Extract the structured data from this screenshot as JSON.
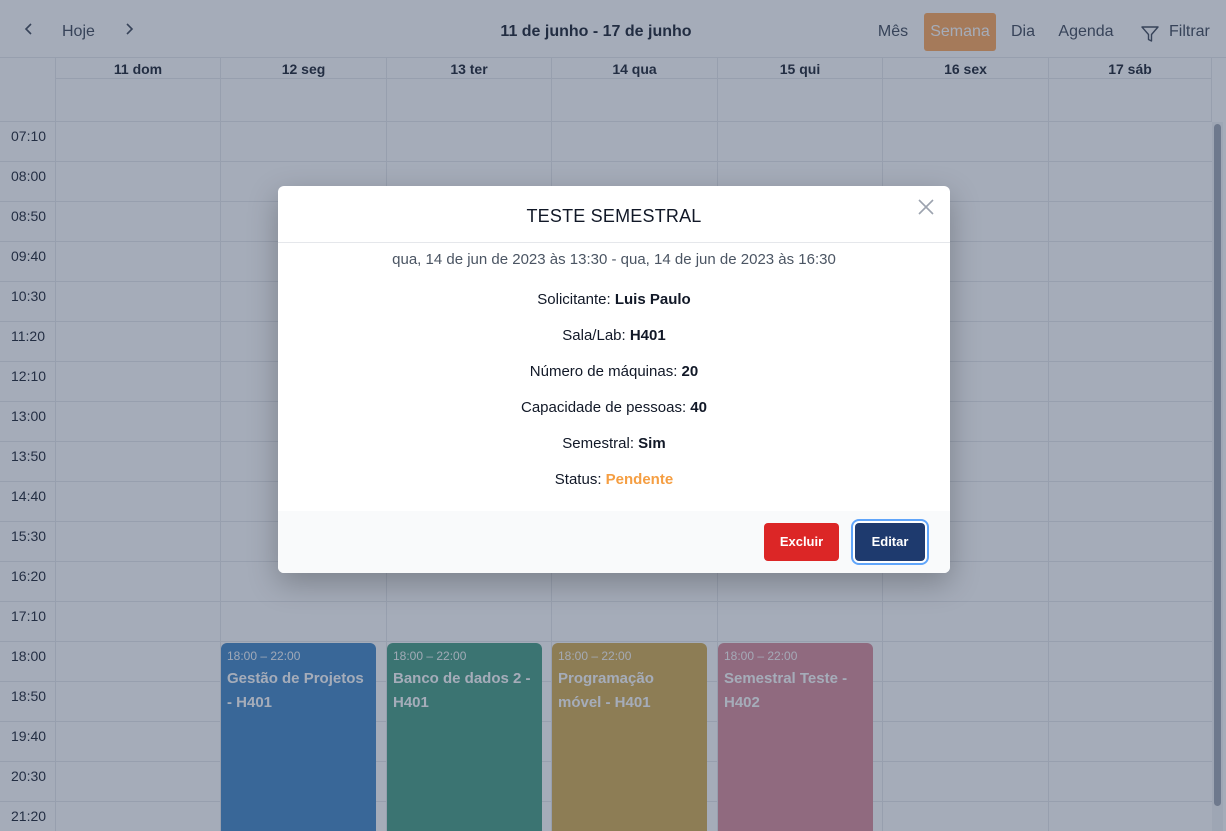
{
  "toolbar": {
    "today_label": "Hoje",
    "range_title": "11 de junho - 17 de junho",
    "views": [
      "Mês",
      "Semana",
      "Dia",
      "Agenda"
    ],
    "active_view": "Semana",
    "filter_label": "Filtrar"
  },
  "days": [
    "11 dom",
    "12 seg",
    "13 ter",
    "14 qua",
    "15 qui",
    "16 sex",
    "17 sáb"
  ],
  "times": [
    "07:10",
    "08:00",
    "08:50",
    "09:40",
    "10:30",
    "11:20",
    "12:10",
    "13:00",
    "13:50",
    "14:40",
    "15:30",
    "16:20",
    "17:10",
    "18:00",
    "18:50",
    "19:40",
    "20:30",
    "21:20"
  ],
  "events": [
    {
      "time": "18:00 – 22:00",
      "title": "Gestão de Projetos - H401",
      "color": "#3b82c4"
    },
    {
      "time": "18:00 – 22:00",
      "title": "Banco de dados 2 - H401",
      "color": "#3f9a7e"
    },
    {
      "time": "18:00 – 22:00",
      "title": "Programação móvel - H401",
      "color": "#d4a94a"
    },
    {
      "time": "18:00 – 22:00",
      "title": "Semestral Teste - H402",
      "color": "#d98896"
    }
  ],
  "modal": {
    "title": "TESTE SEMESTRAL",
    "range": "qua, 14 de jun de 2023 às 13:30 - qua, 14 de jun de 2023 às 16:30",
    "fields": {
      "requester_label": "Solicitante:",
      "requester_value": "Luis Paulo",
      "room_label": "Sala/Lab:",
      "room_value": "H401",
      "machines_label": "Número de máquinas:",
      "machines_value": "20",
      "capacity_label": "Capacidade de pessoas:",
      "capacity_value": "40",
      "semester_label": "Semestral:",
      "semester_value": "Sim",
      "status_label": "Status:",
      "status_value": "Pendente"
    },
    "delete_label": "Excluir",
    "edit_label": "Editar"
  },
  "colors": {
    "accent": "#ffa552",
    "delete": "#dc2626",
    "edit": "#1e3a6e",
    "pending": "#f59e42"
  }
}
